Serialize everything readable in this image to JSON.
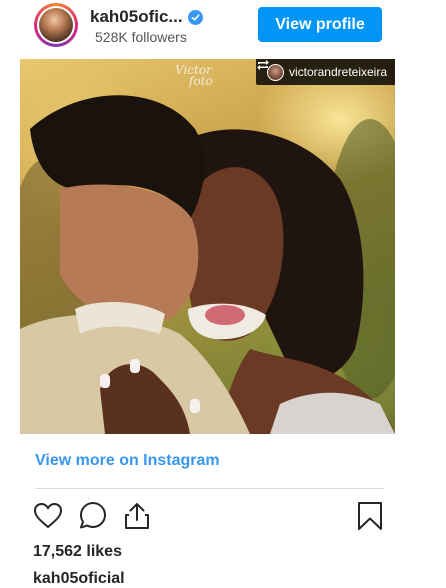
{
  "header": {
    "username": "kah05ofic...",
    "followers": "528K followers",
    "view_profile_label": "View profile"
  },
  "post": {
    "repost_user": "victorandreteixeira",
    "watermark_line1": "Victor",
    "watermark_line2": "foto"
  },
  "footer": {
    "view_more_label": "View more on Instagram",
    "likes": "17,562 likes",
    "caption_username": "kah05oficial"
  },
  "icons": [
    "verified-badge-icon",
    "repost-icon",
    "heart-icon",
    "comment-icon",
    "share-icon",
    "bookmark-icon"
  ],
  "colors": {
    "accent": "#0095f6",
    "link": "#3897f0",
    "text": "#262626"
  }
}
